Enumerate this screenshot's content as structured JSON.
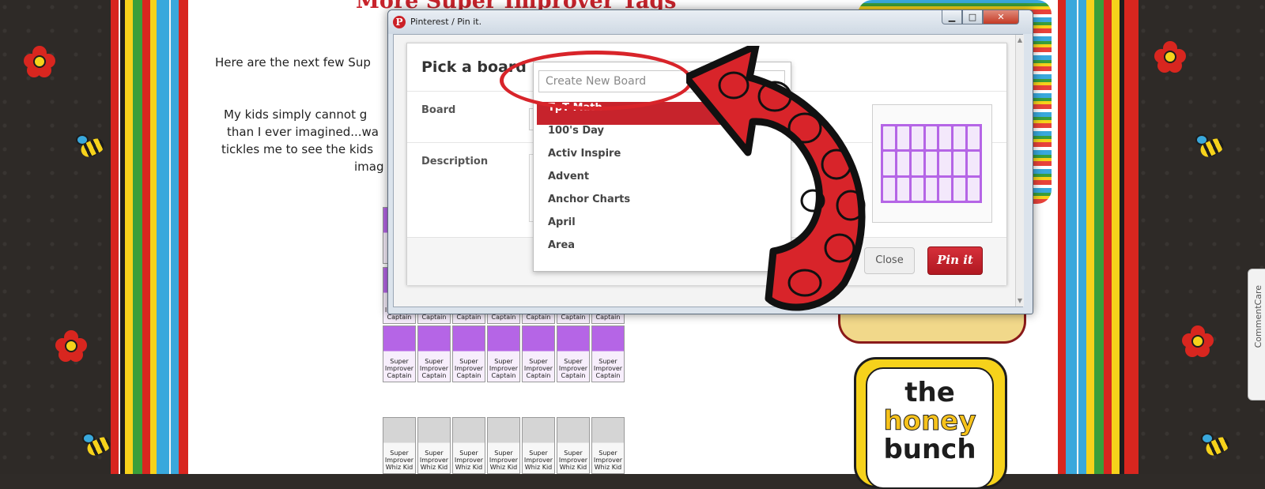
{
  "background": {
    "blog_title": "More Super Improver Tags",
    "paragraph": [
      "Here are the next few Sup",
      "My kids simply cannot g",
      "than I ever imagined...wa",
      "tickles me to see the kids",
      "imag"
    ],
    "purple_tag_label": [
      "Super",
      "Improver",
      "Captain"
    ],
    "grey_tag_label": [
      "Super",
      "Improver",
      "Whiz Kid"
    ],
    "badge_lines": [
      "the",
      "honey",
      "bunch"
    ],
    "side_tab_label": "CommentCare",
    "colors": {
      "stripe_red": "#d8261f",
      "stripe_blue": "#39a8dc",
      "stripe_yellow": "#f6d21b",
      "stripe_green": "#3a9e3a"
    }
  },
  "window": {
    "title": "Pinterest / Pin it.",
    "app_icon": "pinterest-logo-icon",
    "controls": {
      "minimize": "▁",
      "maximize": "□",
      "close": "✕"
    }
  },
  "dialog": {
    "title": "Pick a board",
    "board_label": "Board",
    "description_label": "Description",
    "close_label": "Close",
    "pin_label": "Pin it",
    "accent": "#c7232c"
  },
  "dropdown": {
    "create_placeholder": "Create New Board",
    "items": [
      "TpT Math",
      "100's Day",
      "Activ Inspire",
      "Advent",
      "Anchor Charts",
      "April",
      "Area"
    ],
    "selected_index": 0
  },
  "annotation": {
    "ring_color": "#d8242a",
    "arrow_color": "#d8242a"
  }
}
